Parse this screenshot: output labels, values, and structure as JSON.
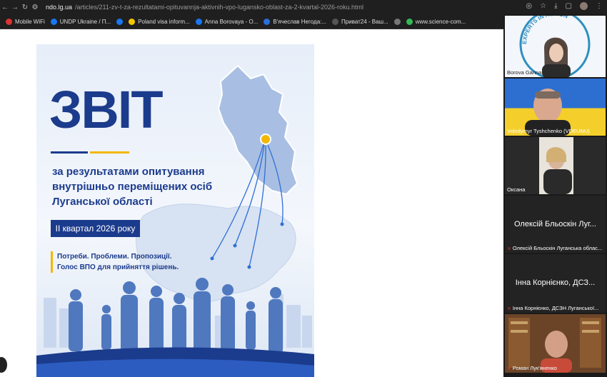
{
  "browser": {
    "url_host": "ndo.lg.ua",
    "url_path": "/articles/211-zv-t-za-rezultatami-opituvannja-aktivnih-vpo-lugansko-oblast-za-2-kvartal-2026-roku.html"
  },
  "bookmarks": [
    {
      "label": "Mobile WiFi",
      "color": "#d33"
    },
    {
      "label": "UNDP Ukraine / П...",
      "color": "#1877f2"
    },
    {
      "label": "",
      "color": "#1877f2"
    },
    {
      "label": "Poland visa inform...",
      "color": "#f5c400"
    },
    {
      "label": "Anna Borovaya - О...",
      "color": "#1877f2"
    },
    {
      "label": "В'ячеслав Негода:...",
      "color": "#2a6fdb"
    },
    {
      "label": "Приват24 - Ваш...",
      "color": "#555"
    },
    {
      "label": "",
      "color": "#777"
    },
    {
      "label": "www.science-com...",
      "color": "#3b5"
    }
  ],
  "poster": {
    "title": "ЗВІТ",
    "subtitle": "за результатами опитування внутрішньо переміщених осіб Луганської області",
    "quarter": "ІІ квартал 2026 року",
    "tagline1": "Потреби. Проблеми. Пропозиції.",
    "tagline2": "Голос ВПО для прийняття рішень.",
    "colors": {
      "blue": "#1b3b8c",
      "yellow": "#f2b705"
    }
  },
  "participants": [
    {
      "name": "Borova Ganna",
      "type": "video"
    },
    {
      "name": "Volodymyr Tyshchenko (VDEUNU)",
      "type": "video"
    },
    {
      "name": "Оксана",
      "type": "video"
    },
    {
      "name": "Олексій Бльоскін Луганська облас...",
      "display": "Олексій Бльоскін Луг...",
      "type": "name"
    },
    {
      "name": "Інна Корнієнко, ДСЗН Луганської...",
      "display": "Інна Корнієнко, ДСЗ...",
      "type": "name"
    },
    {
      "name": "Роман Лук'яненко",
      "type": "video"
    }
  ],
  "logo_text": "EXPERTS IN ACTION"
}
